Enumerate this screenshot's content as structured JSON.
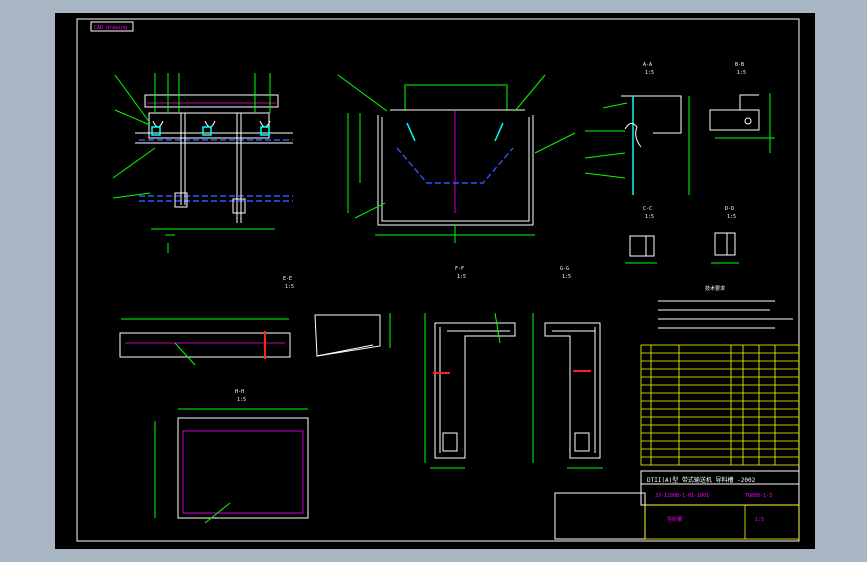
{
  "sheet": {
    "tag": "CAD drawing",
    "bg_color": "#a9b6c3",
    "canvas_color": "#000000"
  },
  "section_labels": {
    "a": "A-A",
    "b": "B-B",
    "c": "C-C",
    "d": "D-D",
    "e": "E-E",
    "f": "F-F",
    "g": "G-G",
    "h": "H-H",
    "scale": "1:5"
  },
  "table": {
    "title": "DTII(A)型 带式输送机 导料槽 -2002",
    "code": "JJ-1280B-1-01-1001",
    "sheet_no": "TQ800-1-3",
    "footer": "导料槽",
    "scale_text": "1:5"
  }
}
